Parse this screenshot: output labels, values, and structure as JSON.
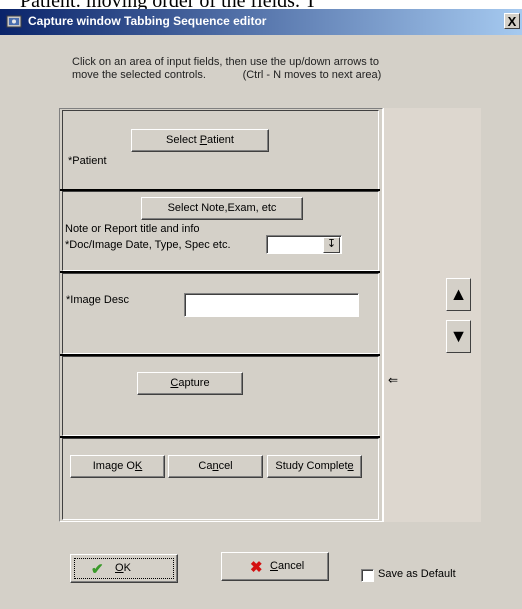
{
  "background_caption": "Patient: moving order of the fields. T",
  "window": {
    "title": "Capture window Tabbing Sequence editor",
    "close_label": "X"
  },
  "instructions": {
    "line1": "Click on an area of input fields, then use the up/down arrows to",
    "line2": "move the selected controls.            (Ctrl - N moves to next area)"
  },
  "sections": {
    "patient": {
      "button_pre": "Select ",
      "button_hot": "P",
      "button_post": "atient",
      "label": "*Patient"
    },
    "note": {
      "button_label": "Select Note,Exam, etc",
      "label1": "Note or Report title and info",
      "label2": "*Doc/Image Date, Type, Spec etc.",
      "combo_value": "",
      "combo_icon": "down-arrow-icon"
    },
    "image_desc": {
      "label": "*Image Desc",
      "value": ""
    },
    "capture": {
      "button_hot": "C",
      "button_post": "apture"
    },
    "actions": {
      "image_ok_pre": "Image O",
      "image_ok_hot": "K",
      "cancel_pre": "Ca",
      "cancel_hot": "n",
      "cancel_post": "cel",
      "study_pre": "Study Complet",
      "study_hot": "e"
    }
  },
  "side": {
    "up_arrow": "▲",
    "down_arrow": "▼",
    "current_marker": "⇐"
  },
  "footer": {
    "ok_hot": "O",
    "ok_post": "K",
    "cancel_hot": "C",
    "cancel_post": "ancel",
    "save_default_label": "Save as Default",
    "save_default_checked": false
  },
  "colors": {
    "title_gradient_start": "#0a246a",
    "title_gradient_end": "#a6caf0",
    "dialog_bg": "#d4d0c8",
    "ok_check": "#3a9a2a",
    "cancel_x": "#d41010"
  }
}
